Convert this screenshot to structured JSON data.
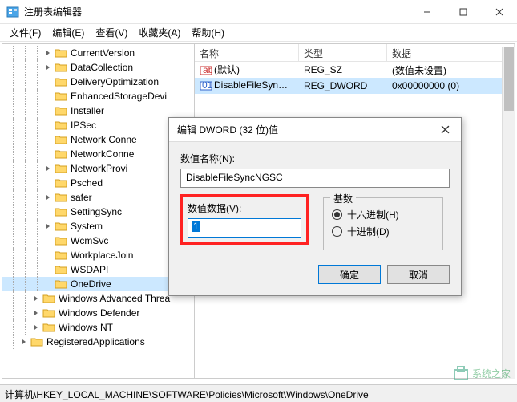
{
  "window": {
    "title": "注册表编辑器"
  },
  "menu": {
    "file": "文件(F)",
    "edit": "编辑(E)",
    "view": "查看(V)",
    "favorites": "收藏夹(A)",
    "help": "帮助(H)"
  },
  "tree": {
    "items": [
      {
        "indent": 3,
        "expand": "closed",
        "label": "CurrentVersion"
      },
      {
        "indent": 3,
        "expand": "closed",
        "label": "DataCollection"
      },
      {
        "indent": 3,
        "expand": "none",
        "label": "DeliveryOptimization"
      },
      {
        "indent": 3,
        "expand": "none",
        "label": "EnhancedStorageDevi"
      },
      {
        "indent": 3,
        "expand": "none",
        "label": "Installer"
      },
      {
        "indent": 3,
        "expand": "none",
        "label": "IPSec"
      },
      {
        "indent": 3,
        "expand": "none",
        "label": "Network Conne"
      },
      {
        "indent": 3,
        "expand": "none",
        "label": "NetworkConne"
      },
      {
        "indent": 3,
        "expand": "closed",
        "label": "NetworkProvi"
      },
      {
        "indent": 3,
        "expand": "none",
        "label": "Psched"
      },
      {
        "indent": 3,
        "expand": "closed",
        "label": "safer"
      },
      {
        "indent": 3,
        "expand": "none",
        "label": "SettingSync"
      },
      {
        "indent": 3,
        "expand": "closed",
        "label": "System"
      },
      {
        "indent": 3,
        "expand": "none",
        "label": "WcmSvc"
      },
      {
        "indent": 3,
        "expand": "none",
        "label": "WorkplaceJoin"
      },
      {
        "indent": 3,
        "expand": "none",
        "label": "WSDAPI"
      },
      {
        "indent": 3,
        "expand": "none",
        "label": "OneDrive",
        "selected": true
      },
      {
        "indent": 2,
        "expand": "closed",
        "label": "Windows Advanced Threa"
      },
      {
        "indent": 2,
        "expand": "closed",
        "label": "Windows Defender"
      },
      {
        "indent": 2,
        "expand": "closed",
        "label": "Windows NT"
      },
      {
        "indent": 1,
        "expand": "closed",
        "label": "RegisteredApplications"
      }
    ]
  },
  "list": {
    "headers": {
      "name": "名称",
      "type": "类型",
      "data": "数据"
    },
    "rows": [
      {
        "icon": "string",
        "name": "(默认)",
        "type": "REG_SZ",
        "data": "(数值未设置)"
      },
      {
        "icon": "dword",
        "name": "DisableFileSyn…",
        "type": "REG_DWORD",
        "data": "0x00000000 (0)",
        "selected": true
      }
    ]
  },
  "dialog": {
    "title": "编辑 DWORD (32 位)值",
    "name_label": "数值名称(N):",
    "name_value": "DisableFileSyncNGSC",
    "data_label": "数值数据(V):",
    "data_value": "1",
    "base_label": "基数",
    "radio_hex": "十六进制(H)",
    "radio_dec": "十进制(D)",
    "ok": "确定",
    "cancel": "取消"
  },
  "statusbar": "计算机\\HKEY_LOCAL_MACHINE\\SOFTWARE\\Policies\\Microsoft\\Windows\\OneDrive",
  "watermark": "系统之家"
}
